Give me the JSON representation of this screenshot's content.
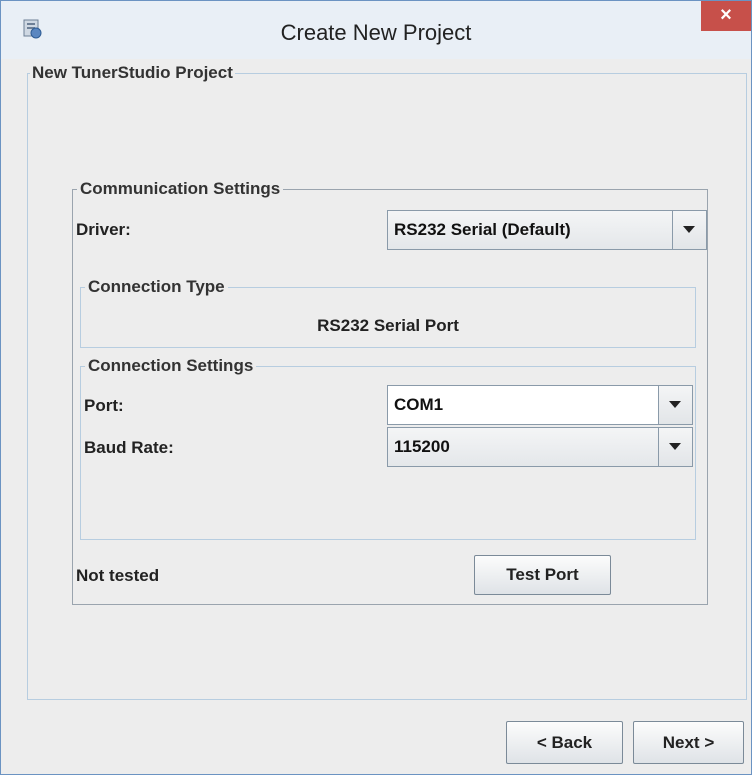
{
  "window": {
    "title": "Create New Project",
    "close_glyph": "×",
    "icon": "app-icon"
  },
  "project_group": {
    "legend": "New TunerStudio Project"
  },
  "comm_settings": {
    "legend": "Communication Settings",
    "driver_label": "Driver:",
    "driver_value": "RS232 Serial (Default)",
    "connection_type": {
      "legend": "Connection Type",
      "value": "RS232 Serial Port"
    },
    "connection_settings": {
      "legend": "Connection Settings",
      "port_label": "Port:",
      "port_value": "COM1",
      "baud_label": "Baud Rate:",
      "baud_value": "115200"
    },
    "status_text": "Not tested",
    "test_button": "Test Port"
  },
  "footer": {
    "back_button": "< Back",
    "next_button": "Next >"
  },
  "colors": {
    "close": "#c7504a",
    "border": "#b7cde0",
    "background": "#ededed"
  }
}
